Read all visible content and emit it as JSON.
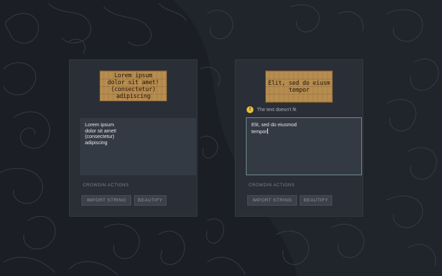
{
  "left_panel": {
    "sign_text": "Lorem ipsum\ndolor sit amet!\n(consectetur)\nadipiscing",
    "textarea_value": "Lorem ipsum\ndolor sit amet!\n(consectetur)\nadipiscing",
    "actions_label": "CROWDIN ACTIONS",
    "import_label": "IMPORT STRING",
    "beautify_label": "BEAUTIFY"
  },
  "right_panel": {
    "sign_text": "Elit, sed do eiusm\ntempor",
    "warning_icon": "!",
    "warning_text": "The text doesn't fit",
    "textarea_value": "Elit, sed do eiusmod\ntempor",
    "actions_label": "CROWDIN ACTIONS",
    "import_label": "IMPORT STRING",
    "beautify_label": "BEAUTIFY"
  },
  "colors": {
    "background": "#1b1e25",
    "panel": "#2a2e36",
    "sign_wood": "#b3884d",
    "warning": "#e7c236",
    "focus_border": "#6f8f8f"
  }
}
